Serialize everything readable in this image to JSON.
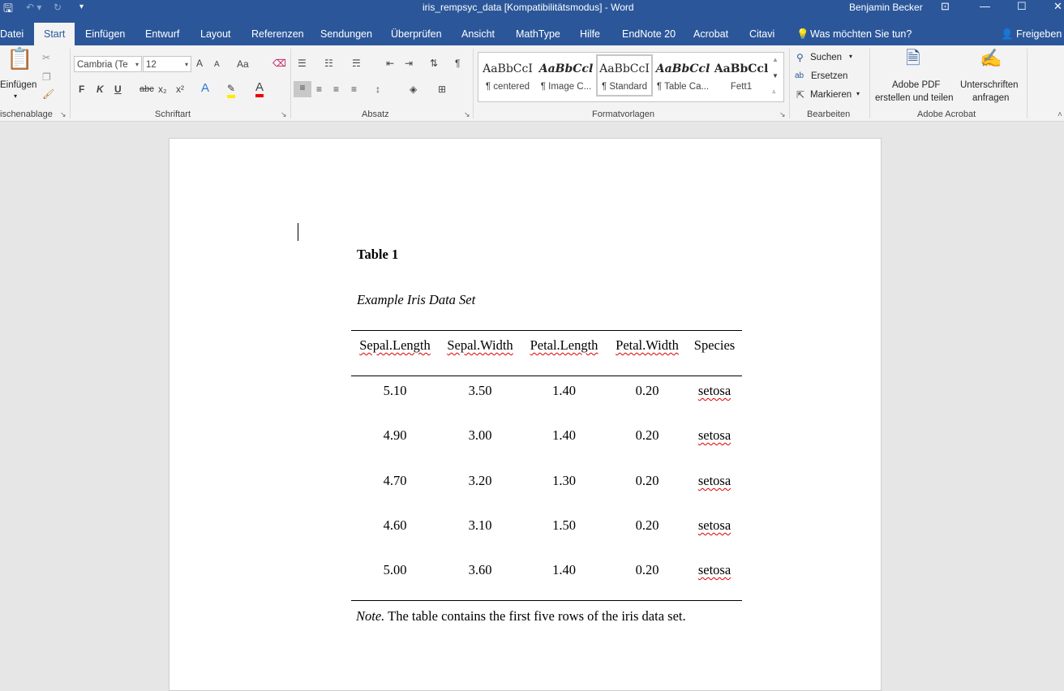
{
  "titlebar": {
    "document_title": "iris_rempsyc_data [Kompatibilitätsmodus]  -  Word",
    "user": "Benjamin Becker"
  },
  "tabs": [
    "Datei",
    "Start",
    "Einfügen",
    "Entwurf",
    "Layout",
    "Referenzen",
    "Sendungen",
    "Überprüfen",
    "Ansicht",
    "MathType",
    "Hilfe",
    "EndNote 20",
    "Acrobat",
    "Citavi"
  ],
  "tell_me": "Was möchten Sie tun?",
  "share": "Freigeben",
  "ribbon": {
    "clipboard": {
      "paste": "Einfügen",
      "group": "ischenablage"
    },
    "font": {
      "family": "Cambria (Te",
      "size": "12",
      "bold": "F",
      "italic": "K",
      "underline": "U",
      "strike": "abc",
      "sub": "x₂",
      "sup": "x²",
      "case": "Aa",
      "grow": "A",
      "shrink": "A",
      "group": "Schriftart"
    },
    "paragraph": {
      "group": "Absatz"
    },
    "styles": {
      "group": "Formatvorlagen",
      "items": [
        {
          "preview": "AaBbCcI",
          "name": "¶ centered"
        },
        {
          "preview": "AaBbCcl",
          "name": "¶ Image C..."
        },
        {
          "preview": "AaBbCcI",
          "name": "¶ Standard"
        },
        {
          "preview": "AaBbCcl",
          "name": "¶ Table Ca..."
        },
        {
          "preview": "AaBbCcl",
          "name": "Fett1"
        }
      ]
    },
    "editing": {
      "find": "Suchen",
      "replace": "Ersetzen",
      "select": "Markieren",
      "group": "Bearbeiten"
    },
    "acrobat": {
      "create_pdf_1": "Adobe PDF",
      "create_pdf_2": "erstellen und teilen",
      "sign_1": "Unterschriften",
      "sign_2": "anfragen",
      "group": "Adobe Acrobat"
    }
  },
  "document": {
    "table_label": "Table 1",
    "table_title": "Example Iris Data Set",
    "columns": [
      "Sepal.Length",
      "Sepal.Width",
      "Petal.Length",
      "Petal.Width",
      "Species"
    ],
    "rows": [
      [
        "5.10",
        "3.50",
        "1.40",
        "0.20",
        "setosa"
      ],
      [
        "4.90",
        "3.00",
        "1.40",
        "0.20",
        "setosa"
      ],
      [
        "4.70",
        "3.20",
        "1.30",
        "0.20",
        "setosa"
      ],
      [
        "4.60",
        "3.10",
        "1.50",
        "0.20",
        "setosa"
      ],
      [
        "5.00",
        "3.60",
        "1.40",
        "0.20",
        "setosa"
      ]
    ],
    "note_label": "Note.",
    "note_text": " The table contains the first five rows of the iris data set."
  }
}
